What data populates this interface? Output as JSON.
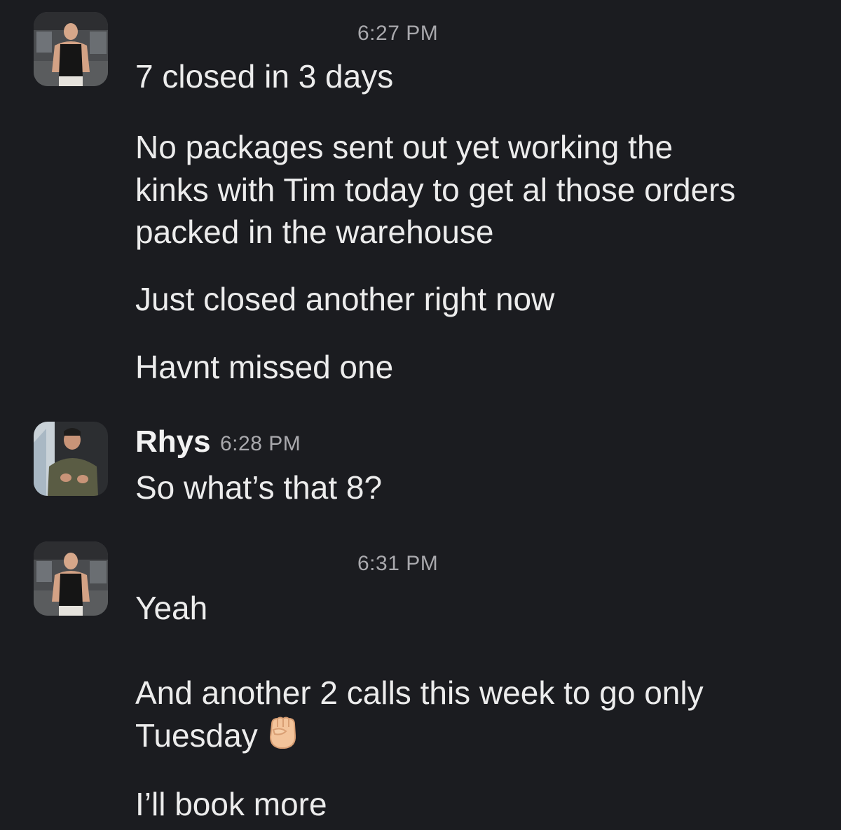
{
  "messages": [
    {
      "time": "6:27 PM",
      "lines": [
        "7 closed in 3 days",
        "No packages sent out yet working the",
        "kinks with Tim today to get al those orders",
        "packed in the warehouse",
        "Just closed another right now",
        "Havnt missed one"
      ]
    },
    {
      "author": "Rhys",
      "time": "6:28 PM",
      "lines": [
        "So what’s that 8?"
      ]
    },
    {
      "time": "6:31 PM",
      "lines": [
        "Yeah",
        "And another 2 calls this week to go only",
        "Tuesday",
        "I’ll book more"
      ],
      "emoji": "raised-fist-emoji"
    }
  ],
  "colors": {
    "background": "#1b1c20",
    "text": "#ececec",
    "timestamp": "#a9a9ad"
  }
}
